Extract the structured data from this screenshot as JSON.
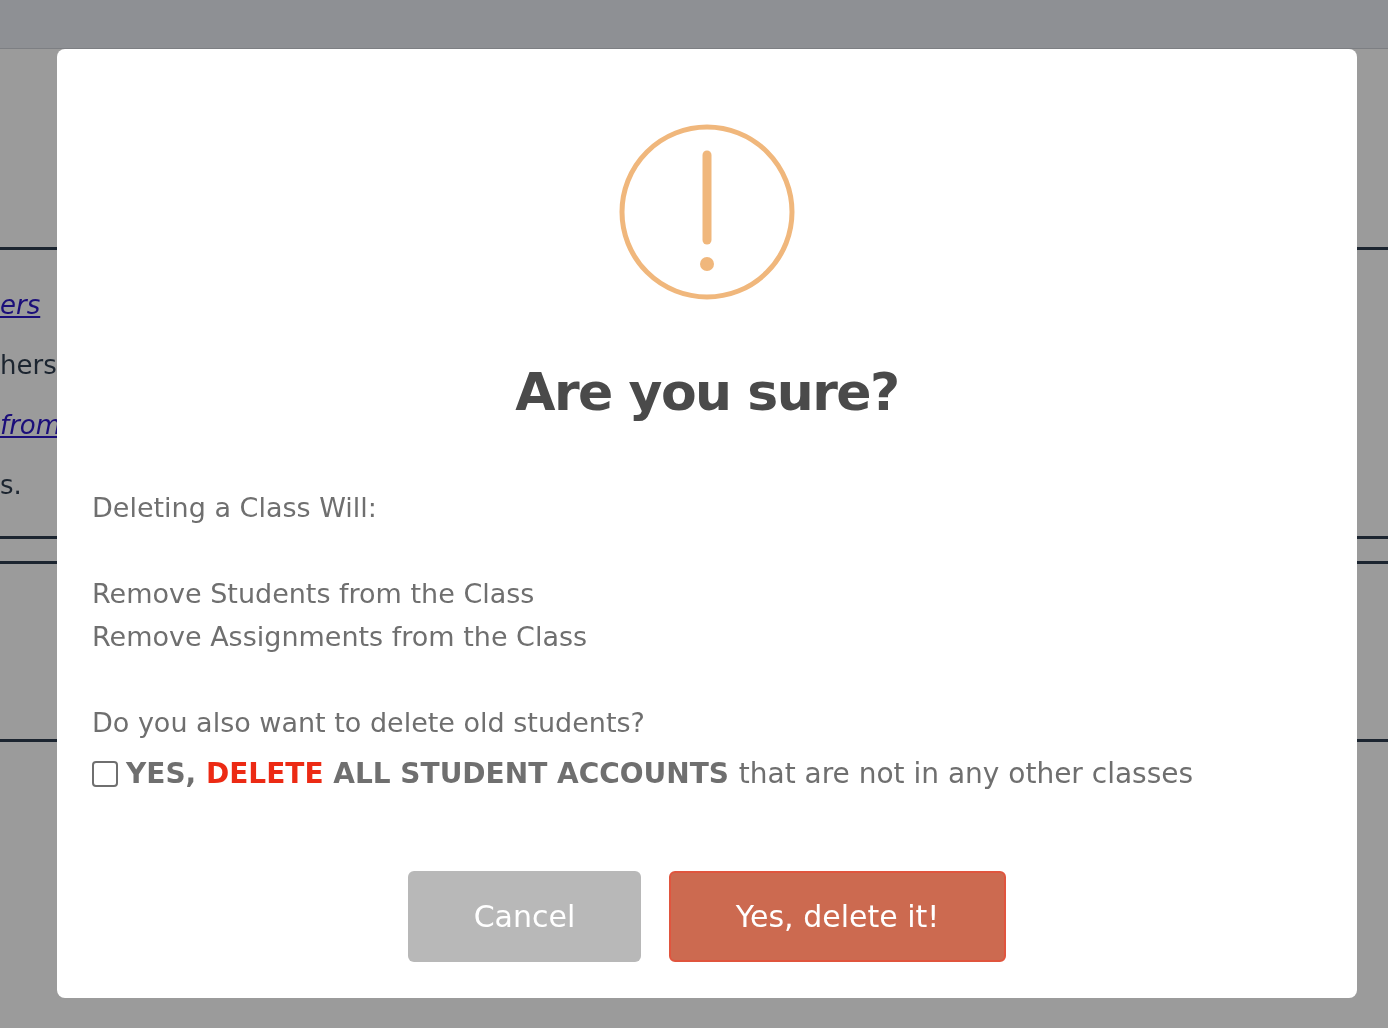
{
  "background": {
    "texts": [
      {
        "text": "ers",
        "kind": "link"
      },
      {
        "text": "hers",
        "kind": "plain"
      },
      {
        "text": "from",
        "kind": "link"
      },
      {
        "text": "s.",
        "kind": "plain"
      }
    ]
  },
  "dialog": {
    "title": "Are you sure?",
    "intro": "Deleting a Class Will:",
    "effects": [
      "Remove Students from the Class",
      "Remove Assignments from the Class"
    ],
    "question": "Do you also want to delete old students?",
    "option": {
      "checked": false,
      "parts": [
        {
          "text": "YES,",
          "kind": "strong"
        },
        {
          "text": "DELETE",
          "kind": "danger"
        },
        {
          "text": "ALL STUDENT ACCOUNTS",
          "kind": "strong"
        },
        {
          "text": "that are not in any other classes",
          "kind": "plain"
        }
      ]
    },
    "buttons": [
      {
        "label": "Cancel",
        "kind": "cancel"
      },
      {
        "label": "Yes, delete it!",
        "kind": "confirm"
      }
    ]
  }
}
